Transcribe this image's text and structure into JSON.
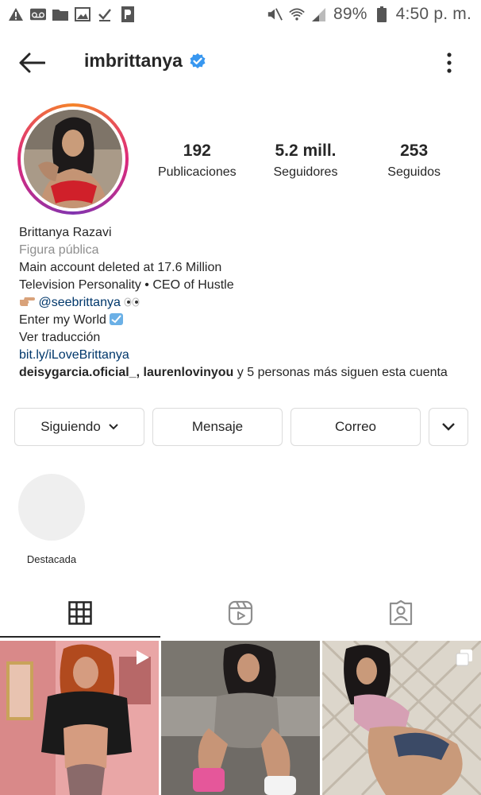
{
  "status_bar": {
    "battery": "89%",
    "time": "4:50 p. m."
  },
  "header": {
    "username": "imbrittanya"
  },
  "stats": [
    {
      "value": "192",
      "label": "Publicaciones"
    },
    {
      "value": "5.2 mill.",
      "label": "Seguidores"
    },
    {
      "value": "253",
      "label": "Seguidos"
    }
  ],
  "bio": {
    "name": "Brittanya Razavi",
    "category": "Figura pública",
    "line1": "Main account deleted at 17.6 Million",
    "line2": "Television Personality • CEO of Hustle",
    "mention": "@seebrittanya",
    "line4": "Enter my World",
    "translate": "Ver traducción",
    "link": "bit.ly/iLoveBrittanya",
    "followed_names": "deisygarcia.oficial_, laurenlovinyou",
    "followed_rest": " y 5 personas más siguen esta cuenta"
  },
  "actions": {
    "following": "Siguiendo",
    "message": "Mensaje",
    "email": "Correo"
  },
  "highlights": [
    {
      "label": "Destacada"
    }
  ],
  "colors": {
    "verified": "#3897f0",
    "link": "#00376b",
    "secondary_text": "#8e8e8e"
  }
}
